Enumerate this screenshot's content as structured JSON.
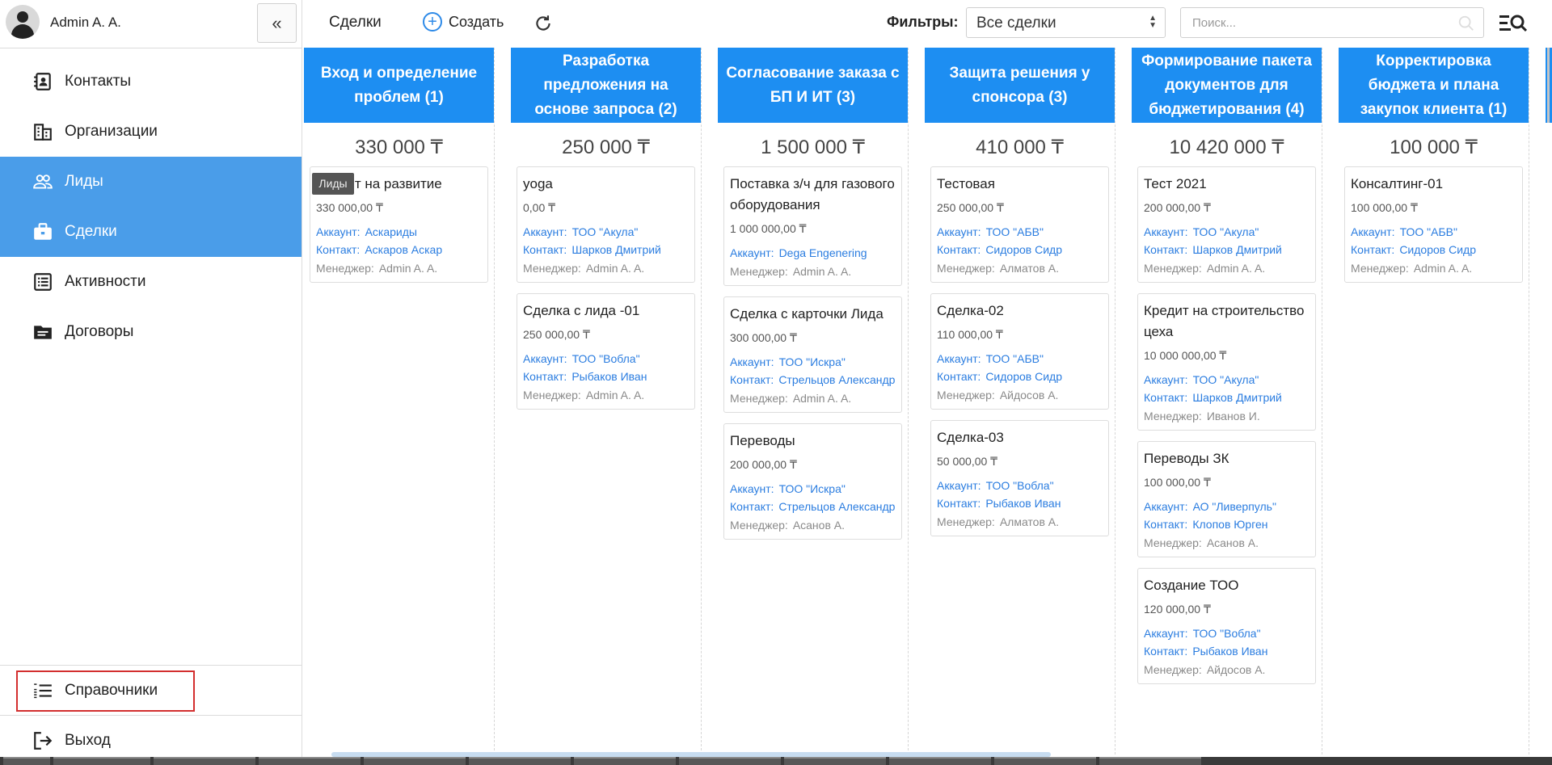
{
  "sidebar": {
    "user_name": "Admin A. A.",
    "collapse_label": "«",
    "items": [
      {
        "label": "Контакты",
        "icon": "contacts-icon"
      },
      {
        "label": "Организации",
        "icon": "organizations-icon"
      },
      {
        "label": "Лиды",
        "icon": "leads-icon"
      },
      {
        "label": "Сделки",
        "icon": "deals-icon"
      },
      {
        "label": "Активности",
        "icon": "activities-icon"
      },
      {
        "label": "Договоры",
        "icon": "contracts-icon"
      }
    ],
    "tooltip": "Лиды",
    "dictionaries_label": "Справочники",
    "logout_label": "Выход",
    "accent_color": "#4a9de9"
  },
  "toolbar": {
    "title": "Сделки",
    "create_label": "Создать",
    "filters_label": "Фильтры:",
    "filter_value": "Все сделки",
    "search_placeholder": "Поиск..."
  },
  "board": {
    "header_color": "#1d8ef2",
    "labels": {
      "account": "Аккаунт:",
      "contact": "Контакт:",
      "manager": "Менеджер:"
    },
    "columns": [
      {
        "title": "Вход и определение проблем (1)",
        "sum": "330 000 ₸",
        "cards": [
          {
            "title": "Кредит на развитие",
            "amount": "330 000,00 ₸",
            "account": "Аскариды",
            "contact": "Аскаров Аскар",
            "manager": "Admin A. A."
          }
        ]
      },
      {
        "title": "Разработка предложения на основе запроса (2)",
        "sum": "250 000 ₸",
        "cards": [
          {
            "title": "yoga",
            "amount": "0,00 ₸",
            "account": "ТОО \"Акула\"",
            "contact": "Шарков Дмитрий",
            "manager": "Admin A. A."
          },
          {
            "title": "Сделка с лида -01",
            "amount": "250 000,00 ₸",
            "account": "ТОО \"Вобла\"",
            "contact": "Рыбаков Иван",
            "manager": "Admin A. A."
          }
        ]
      },
      {
        "title": "Согласование заказа с БП И ИТ (3)",
        "sum": "1 500 000 ₸",
        "cards": [
          {
            "title": "Поставка з/ч для газового оборудования",
            "amount": "1 000 000,00 ₸",
            "account": "Dega Engenering",
            "contact": "",
            "manager": "Admin A. A."
          },
          {
            "title": "Сделка с карточки Лида",
            "amount": "300 000,00 ₸",
            "account": "ТОО \"Искра\"",
            "contact": "Стрельцов Александр",
            "manager": "Admin A. A."
          },
          {
            "title": "Переводы",
            "amount": "200 000,00 ₸",
            "account": "ТОО \"Искра\"",
            "contact": "Стрельцов Александр",
            "manager": "Асанов А."
          }
        ]
      },
      {
        "title": "Защита решения у спонсора (3)",
        "sum": "410 000 ₸",
        "cards": [
          {
            "title": "Тестовая",
            "amount": "250 000,00 ₸",
            "account": "ТОО \"АБВ\"",
            "contact": "Сидоров Сидр",
            "manager": "Алматов А."
          },
          {
            "title": "Сделка-02",
            "amount": "110 000,00 ₸",
            "account": "ТОО \"АБВ\"",
            "contact": "Сидоров Сидр",
            "manager": "Айдосов А."
          },
          {
            "title": "Сделка-03",
            "amount": "50 000,00 ₸",
            "account": "ТОО \"Вобла\"",
            "contact": "Рыбаков Иван",
            "manager": "Алматов А."
          }
        ]
      },
      {
        "title": "Формирование пакета документов для бюджетирования (4)",
        "sum": "10 420 000 ₸",
        "cards": [
          {
            "title": "Тест 2021",
            "amount": "200 000,00 ₸",
            "account": "ТОО \"Акула\"",
            "contact": "Шарков Дмитрий",
            "manager": "Admin A. A."
          },
          {
            "title": "Кредит на строительство цеха",
            "amount": "10 000 000,00 ₸",
            "account": "ТОО \"Акула\"",
            "contact": "Шарков Дмитрий",
            "manager": "Иванов И."
          },
          {
            "title": "Переводы ЗК",
            "amount": "100 000,00 ₸",
            "account": "АО \"Ливерпуль\"",
            "contact": "Клопов Юрген",
            "manager": "Асанов А."
          },
          {
            "title": "Создание ТОО",
            "amount": "120 000,00 ₸",
            "account": "ТОО \"Вобла\"",
            "contact": "Рыбаков Иван",
            "manager": "Айдосов А."
          }
        ]
      },
      {
        "title": "Корректировка бюджета и плана закупок клиента (1)",
        "sum": "100 000 ₸",
        "cards": [
          {
            "title": "Консалтинг-01",
            "amount": "100 000,00 ₸",
            "account": "ТОО \"АБВ\"",
            "contact": "Сидоров Сидр",
            "manager": "Admin A. A."
          }
        ]
      }
    ]
  }
}
